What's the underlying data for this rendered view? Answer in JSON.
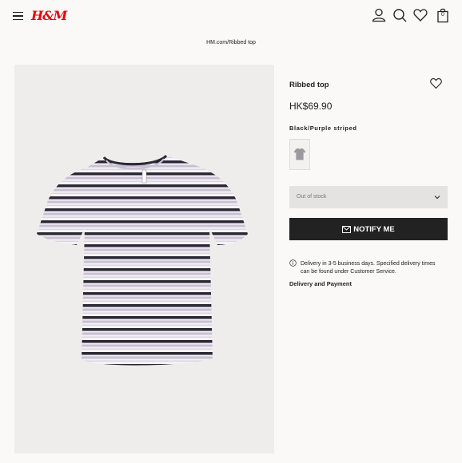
{
  "header": {
    "logo": "H&M",
    "icons": [
      "menu-icon",
      "account-icon",
      "search-icon",
      "heart-icon",
      "bag-icon"
    ],
    "bag_count": "0",
    "logo_color": "#e50010"
  },
  "breadcrumb": "HM.com/Ribbed top",
  "product": {
    "title": "Ribbed top",
    "price": "HK$69.90",
    "color_name": "Black/Purple striped",
    "size_select": "Out of stock",
    "notify_label": "NOTIFY ME",
    "delivery_text": "Delivery in 3-5 business days. Specified delivery times can be found under Customer Service.",
    "payment_link": "Delivery and Payment"
  }
}
